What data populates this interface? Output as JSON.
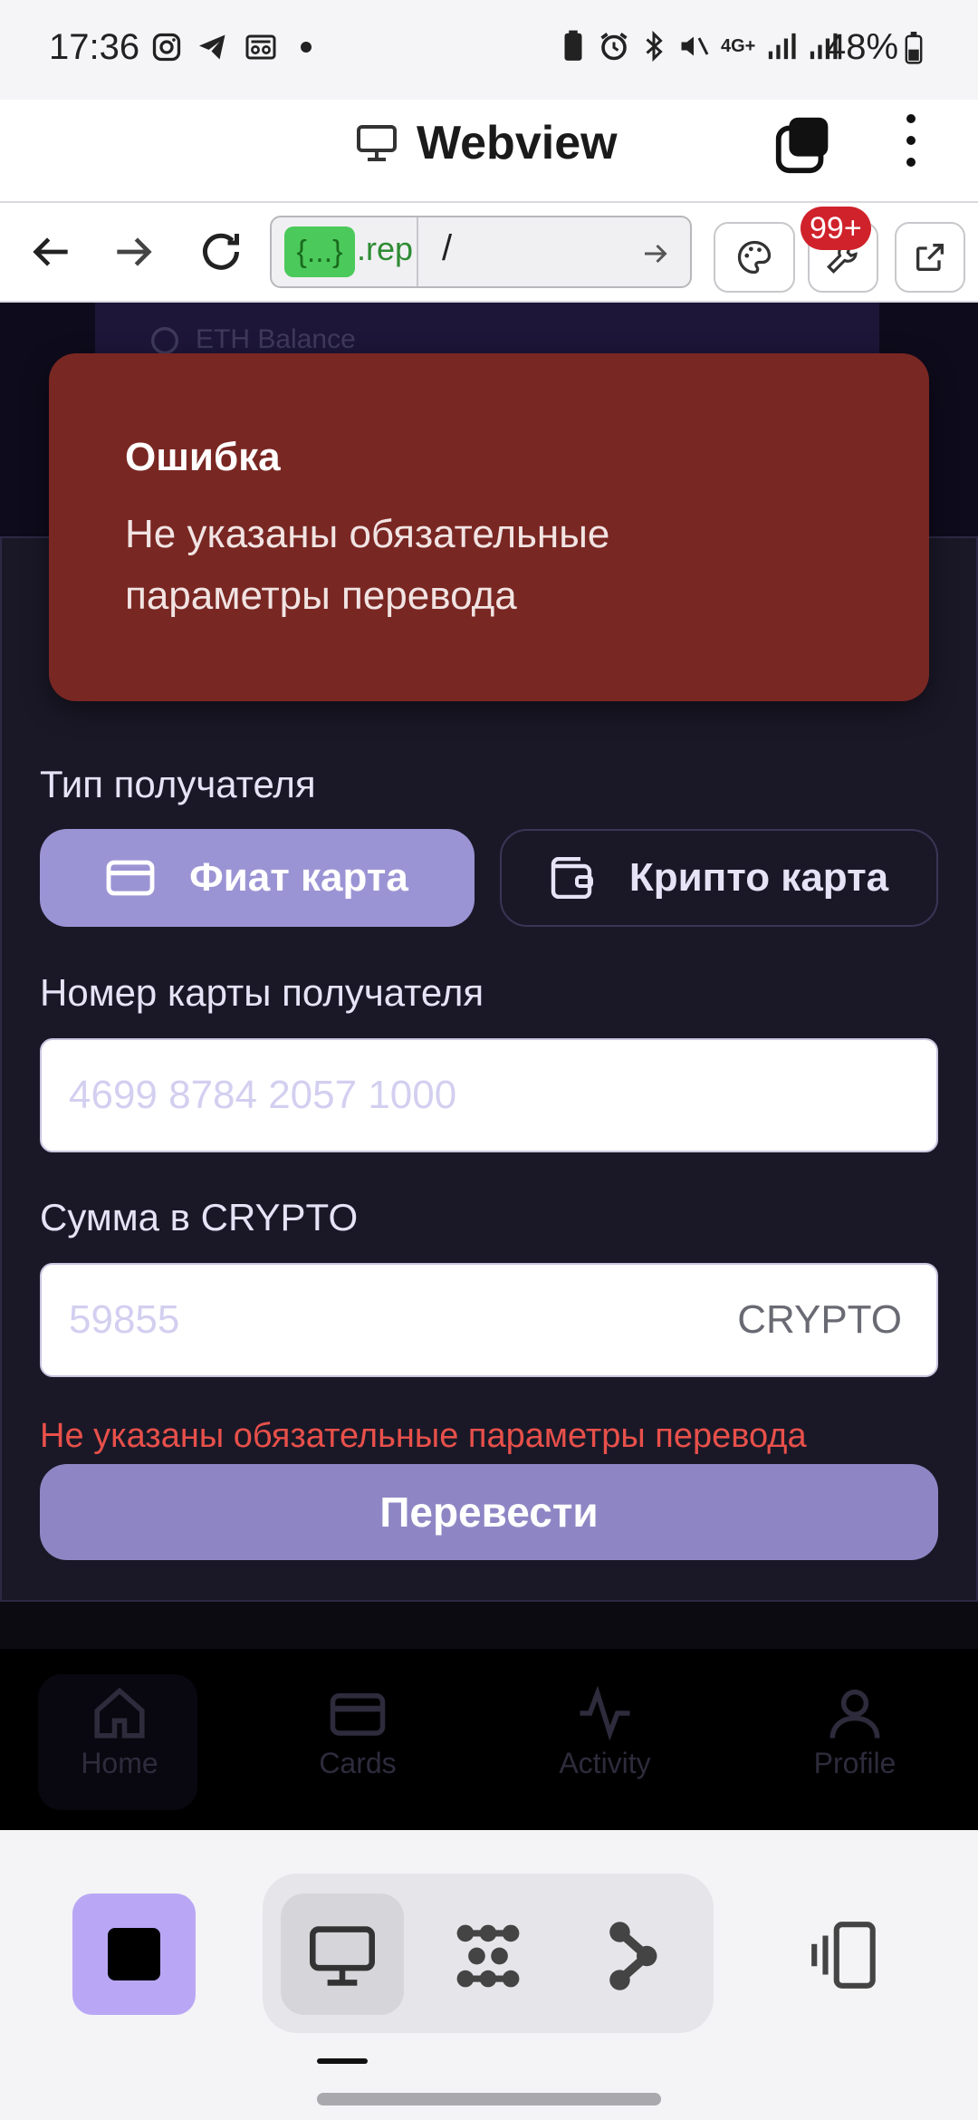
{
  "status_bar": {
    "time": "17:36",
    "battery": "48%"
  },
  "app_header": {
    "title": "Webview"
  },
  "browser": {
    "url_pill": "{...}",
    "url_host_fragment": ".rep",
    "url_path": "/",
    "badge": "99+"
  },
  "background_card": {
    "label": "ETH Balance"
  },
  "toast": {
    "title": "Ошибка",
    "message": "Не указаны обязательные параметры перевода"
  },
  "form": {
    "recipient_type_label": "Тип получателя",
    "option_fiat": "Фиат карта",
    "option_crypto": "Крипто карта",
    "selected_option": "Фиат карта",
    "card_number_label": "Номер карты получателя",
    "card_number_placeholder": "4699 8784 2057 1000",
    "card_number_value": "",
    "amount_label": "Сумма в CRYPTO",
    "amount_placeholder": "59855",
    "amount_value": "",
    "amount_suffix": "CRYPTO",
    "error_text": "Не указаны обязательные параметры перевода",
    "submit_label": "Перевести"
  },
  "bottom_nav": {
    "items": [
      {
        "label": "Home",
        "icon": "home-icon"
      },
      {
        "label": "Cards",
        "icon": "card-icon"
      },
      {
        "label": "Activity",
        "icon": "activity-icon"
      },
      {
        "label": "Profile",
        "icon": "user-icon"
      }
    ]
  },
  "colors": {
    "accent": "#9b94d4",
    "toast_bg": "#792723",
    "error": "#e8504a",
    "panel_bg": "#1a1827"
  }
}
